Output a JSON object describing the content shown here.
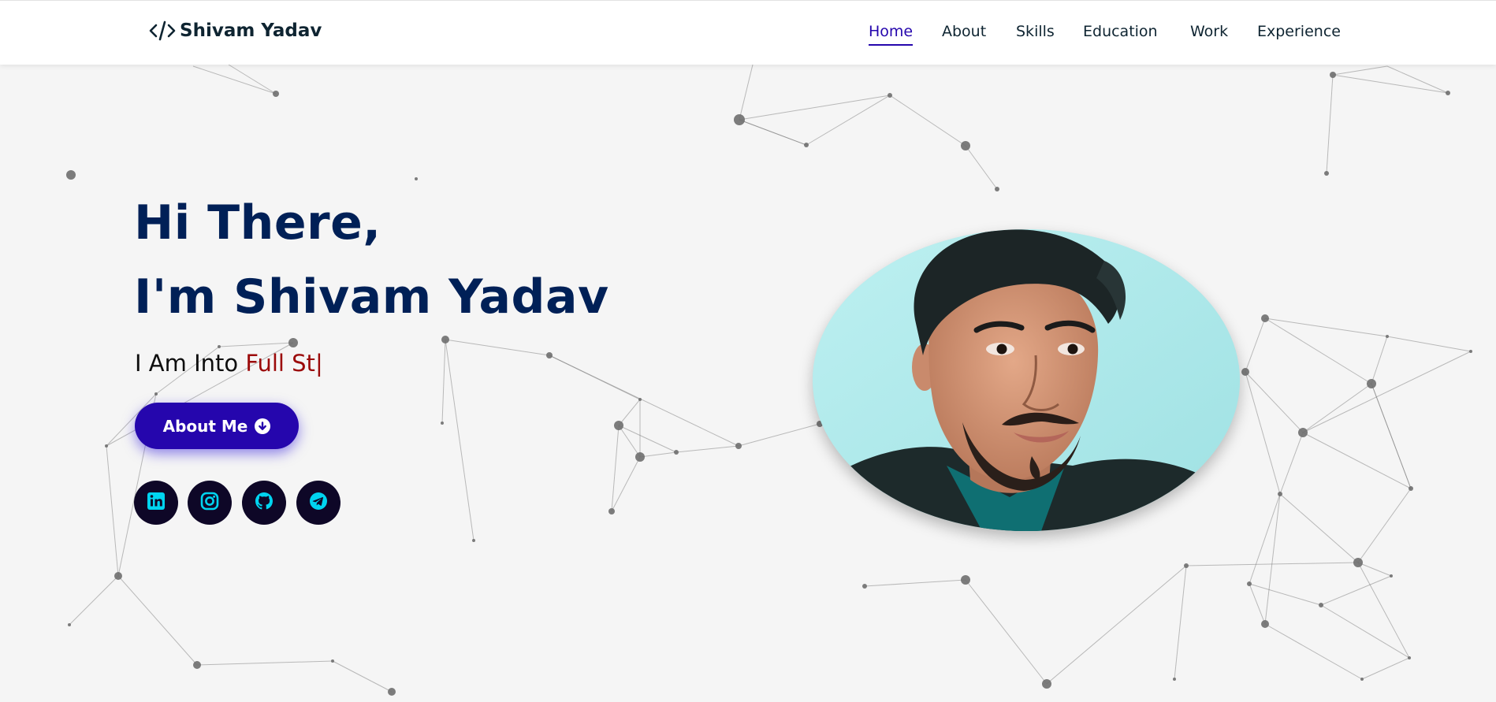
{
  "navbar": {
    "brand_name": "Shivam Yadav",
    "brand_icon": "code-icon",
    "links": [
      {
        "label": "Home",
        "active": true
      },
      {
        "label": "About",
        "active": false
      },
      {
        "label": "Skills",
        "active": false
      },
      {
        "label": "Education",
        "active": false
      },
      {
        "label": "Work",
        "active": false
      },
      {
        "label": "Experience",
        "active": false
      }
    ]
  },
  "hero": {
    "greeting": "Hi There,",
    "intro": "I'm Shivam Yadav",
    "typed_prefix": "I Am Into ",
    "typed_text": "Full St",
    "typed_cursor": "|",
    "about_button": {
      "label": "About Me",
      "icon": "arrow-down-circle-icon"
    },
    "socials": [
      {
        "name": "linkedin",
        "icon": "linkedin-icon"
      },
      {
        "name": "instagram",
        "icon": "instagram-icon"
      },
      {
        "name": "github",
        "icon": "github-icon"
      },
      {
        "name": "telegram",
        "icon": "telegram-icon"
      }
    ],
    "profile_image": "profile-photo"
  },
  "colors": {
    "background": "#f5f5f5",
    "navbar_bg": "#ffffff",
    "heading": "#002057",
    "accent": "#2506ad",
    "typed_text": "#9b0a0a",
    "social_bg": "#0e0727",
    "social_icon": "#00d4f0",
    "particles": "#6f6f6f"
  }
}
